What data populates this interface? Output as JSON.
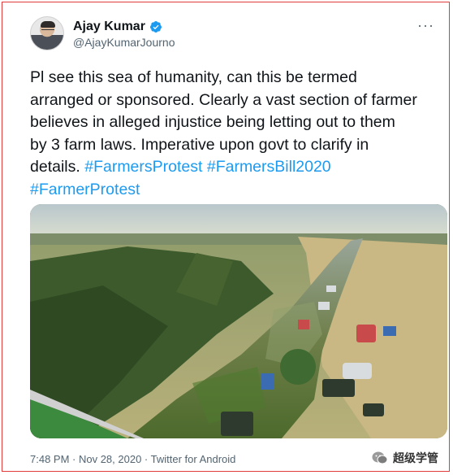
{
  "author": {
    "display_name": "Ajay Kumar",
    "handle": "@AjayKumarJourno"
  },
  "tweet": {
    "text_lines": [
      "Pl  see this sea of humanity, can this be termed",
      "arranged or sponsored. Clearly a vast section of farmer",
      "believes in alleged injustice being letting out to them",
      "by 3 farm laws. Imperative upon govt to clarify in"
    ],
    "text_tail": "details.",
    "hashtags": [
      "#FarmersProtest",
      "#FarmersBill2020",
      "#FarmerProtest"
    ]
  },
  "meta": {
    "timestamp": "7:48 PM · Nov 28, 2020 · Twitter for Android"
  },
  "watermark": {
    "text": "超级学管"
  },
  "colors": {
    "link": "#1d9bf0",
    "text": "#0f1419",
    "secondary": "#536471",
    "frame": "#e23b3b"
  },
  "icons": {
    "verified": "verified-badge-icon",
    "more": "more-options-icon",
    "watermark": "wechat-icon"
  }
}
